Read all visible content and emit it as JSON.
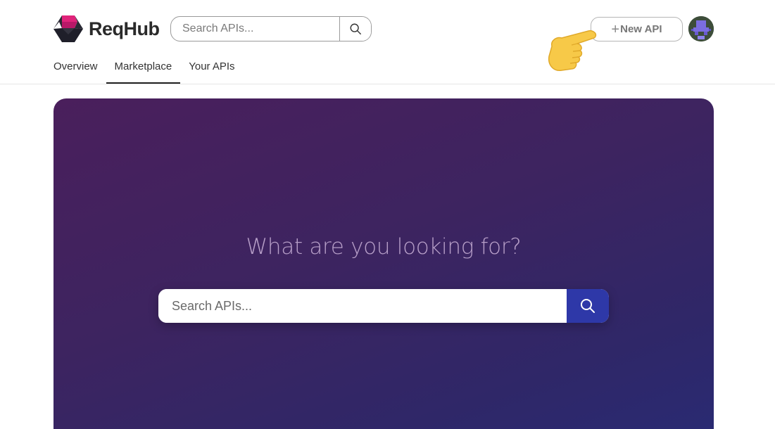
{
  "brand": {
    "name": "ReqHub"
  },
  "header": {
    "search_placeholder": "Search APIs...",
    "new_api_label": "New API",
    "new_api_plus": "+"
  },
  "nav": {
    "items": [
      {
        "label": "Overview",
        "active": false
      },
      {
        "label": "Marketplace",
        "active": true
      },
      {
        "label": "Your APIs",
        "active": false
      }
    ]
  },
  "hero": {
    "title": "What are you looking for?",
    "search_placeholder": "Search APIs..."
  },
  "icons": {
    "logo": "reqhub-logo-icon",
    "search": "search-icon",
    "avatar": "user-avatar",
    "pointer": "pointing-hand-icon"
  },
  "colors": {
    "hero_start": "#4a1f5c",
    "hero_end": "#2a2a72",
    "search_button": "#2e38a8",
    "logo_pink": "#e0237a",
    "logo_dark": "#1f1f2a"
  }
}
